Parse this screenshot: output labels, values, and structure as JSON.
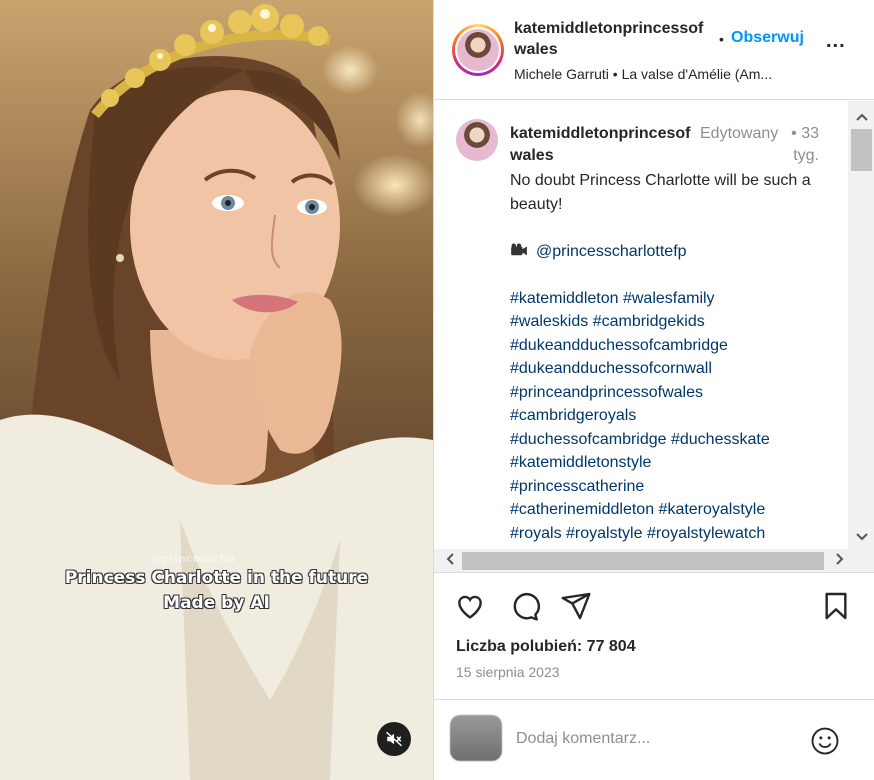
{
  "media": {
    "overlay_line1": "Princess Charlotte in the future",
    "overlay_line2": "Made by AI",
    "watermark": "@princesscha",
    "mute_icon": "speaker-muted-icon"
  },
  "header": {
    "username": "katemiddletonprincessofwales",
    "follow_dot": "•",
    "follow_label": "Obserwuj",
    "more_label": "...",
    "music": "Michele Garruti • La valse d'Amélie (Am..."
  },
  "caption": {
    "username": "katemiddletonprincesofwales",
    "edited": "Edytowany",
    "time": "• 33 tyg.",
    "text": "No doubt Princess Charlotte will be such a beauty!",
    "mention": "@princesscharlottefp",
    "hashtags": [
      "#katemiddleton #walesfamily",
      "#waleskids #cambridgekids",
      "#dukeandduchessofcambridge",
      "#dukeandduchessofcornwall",
      "#princeandprincessofwales",
      "#cambridgeroyals",
      "#duchessofcambridge #duchesskate",
      "#katemiddletonstyle",
      "#princesscatherine",
      "#catherinemiddleton #kateroyalstyle",
      "#royals #royalstyle #royalstylewatch"
    ]
  },
  "scrollbars": {
    "up": "^",
    "down": "v",
    "left": "<",
    "right": ">"
  },
  "actions": {
    "like_icon": "heart-icon",
    "comment_icon": "comment-icon",
    "share_icon": "send-icon",
    "save_icon": "bookmark-icon"
  },
  "stats": {
    "likes": "Liczba polubień: 77 804",
    "date": "15 sierpnia 2023"
  },
  "comment_box": {
    "placeholder": "Dodaj komentarz...",
    "emoji_icon": "smiley-icon"
  },
  "colors": {
    "link_blue": "#0095f6",
    "hashtag": "#00376b",
    "muted_text": "#8e8e8e"
  }
}
